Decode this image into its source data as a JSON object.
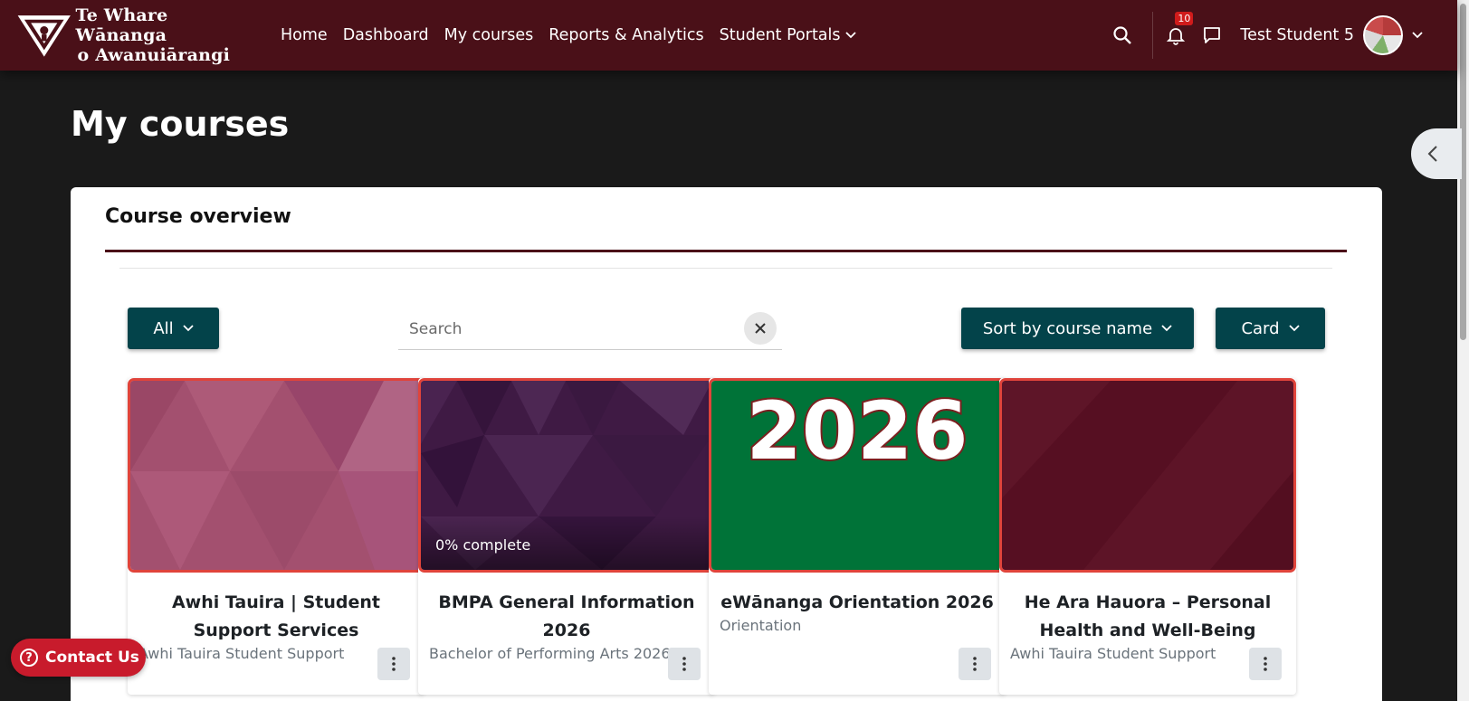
{
  "brand": {
    "line1": "Te Whare Wānanga",
    "line2": "o Awanuiārangi"
  },
  "nav": {
    "items": [
      "Home",
      "Dashboard",
      "My courses",
      "Reports & Analytics",
      "Student Portals"
    ]
  },
  "header_right": {
    "notification_count": "10",
    "user_name": "Test Student 5"
  },
  "page": {
    "title": "My courses"
  },
  "overview": {
    "title": "Course overview",
    "filter_label": "All",
    "search_placeholder": "Search",
    "sort_label": "Sort by course name",
    "view_label": "Card"
  },
  "courses": [
    {
      "title": "Awhi Tauira | Student Support Services",
      "category": "Awhi Tauira Student Support",
      "progress": "",
      "image_color": "#a3506f"
    },
    {
      "title": "BMPA General Information 2026",
      "category": "Bachelor of Performing Arts 2026",
      "progress": "0% complete",
      "image_color": "#3f1a44"
    },
    {
      "title": "eWānanga Orientation 2026",
      "category": "Orientation",
      "progress": "",
      "image_text": "2026",
      "image_color": "#007338"
    },
    {
      "title": "He Ara Hauora – Personal Health and Well-Being",
      "category": "Awhi Tauira Student Support",
      "progress": "",
      "image_color": "#5a1225"
    }
  ],
  "contact": {
    "label": "Contact Us"
  },
  "colors": {
    "navbar": "#4a1018",
    "accent_button": "#03434a",
    "card_outline": "#e0443b",
    "contact": "#c81b2c"
  }
}
